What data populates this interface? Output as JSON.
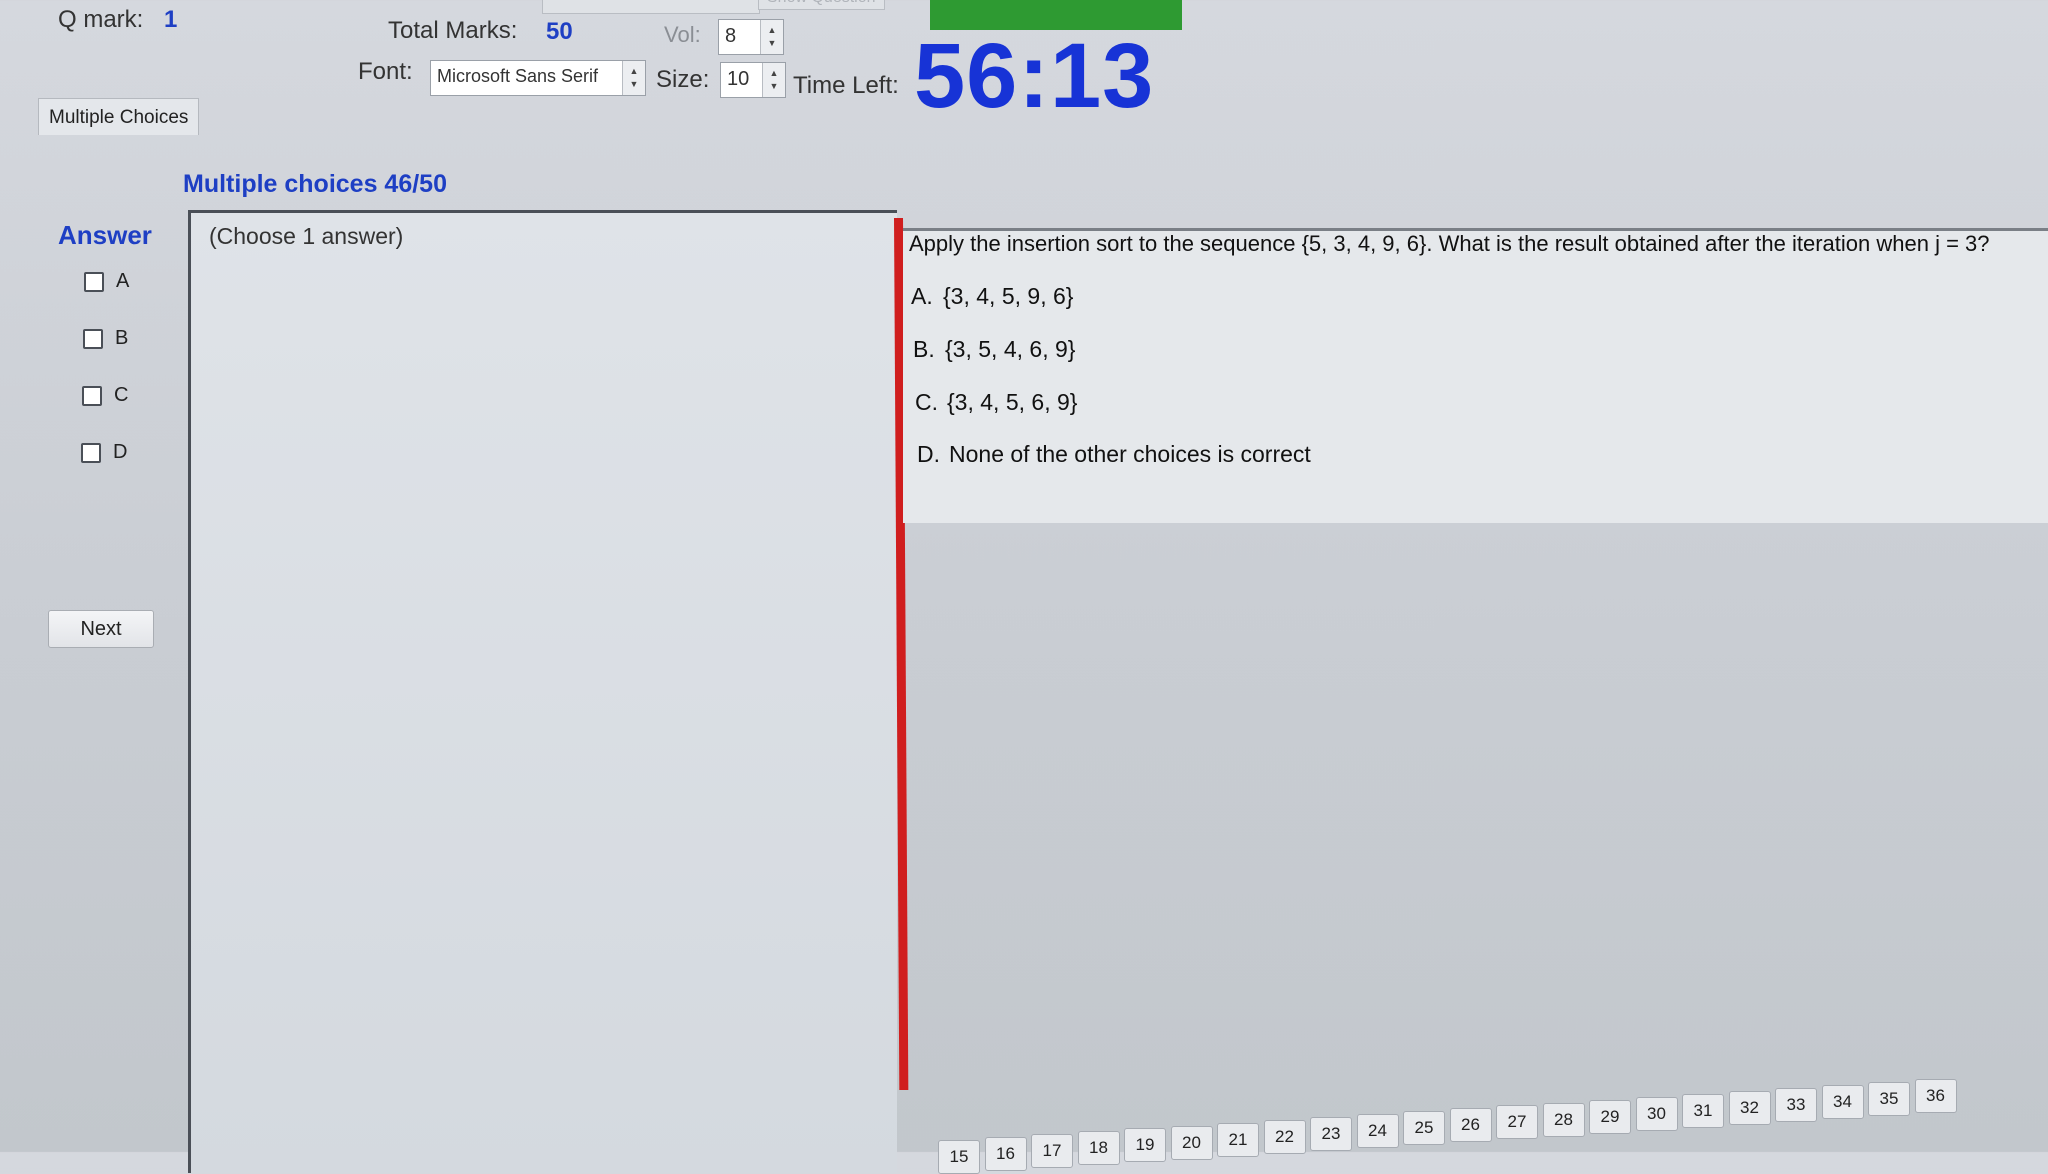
{
  "header": {
    "q_mark_label": "Q mark:",
    "q_mark_value": "1",
    "total_marks_label": "Total Marks:",
    "total_marks_value": "50",
    "vol_label": "Vol:",
    "vol_value": "8",
    "font_label": "Font:",
    "font_value": "Microsoft Sans Serif",
    "size_label": "Size:",
    "size_value": "10",
    "time_left_label": "Time Left:",
    "time_left_value": "56:13",
    "show_question_label": "Show Question",
    "accent_green": "#2e9a32"
  },
  "tab": {
    "label": "Multiple Choices"
  },
  "section": {
    "title": "Multiple choices 46/50"
  },
  "answer": {
    "title": "Answer",
    "options": [
      "A",
      "B",
      "C",
      "D"
    ],
    "next_label": "Next"
  },
  "left_panel": {
    "hint": "(Choose 1 answer)"
  },
  "question": {
    "text": "Apply the insertion sort to the sequence {5, 3, 4, 9, 6}. What is the result obtained after the iteration when j = 3?",
    "choices": [
      {
        "letter": "A.",
        "text": "{3, 4, 5, 9, 6}"
      },
      {
        "letter": "B.",
        "text": "{3, 5, 4, 6, 9}"
      },
      {
        "letter": "C.",
        "text": "{3, 4, 5, 6, 9}"
      },
      {
        "letter": "D.",
        "text": "None of the other choices is correct"
      }
    ]
  },
  "pagination": {
    "pages": [
      "15",
      "16",
      "17",
      "18",
      "19",
      "20",
      "21",
      "22",
      "23",
      "24",
      "25",
      "26",
      "27",
      "28",
      "29",
      "30",
      "31",
      "32",
      "33",
      "34",
      "35",
      "36"
    ]
  },
  "colors": {
    "accent_blue": "#1e3fc4",
    "timer_blue": "#1733d6",
    "divider_red": "#d01e1e"
  }
}
